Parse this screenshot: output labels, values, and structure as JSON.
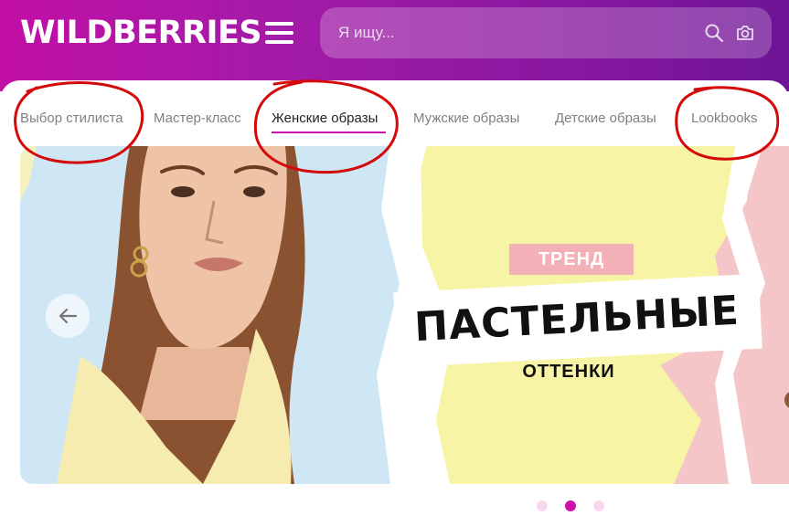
{
  "header": {
    "logo": "WILDBERRIES",
    "search_placeholder": "Я ищу...",
    "gradient_colors": [
      "#c10fa6",
      "#6e1496"
    ]
  },
  "icons": {
    "menu": "hamburger-menu-icon",
    "search": "search-icon",
    "camera": "camera-icon",
    "prev": "arrow-left-icon"
  },
  "tabs": [
    {
      "label": "Выбор стилиста",
      "active": false
    },
    {
      "label": "Мастер-класс",
      "active": false
    },
    {
      "label": "Женские образы",
      "active": true
    },
    {
      "label": "Мужские образы",
      "active": false
    },
    {
      "label": "Детские образы",
      "active": false
    },
    {
      "label": "Lookbooks",
      "active": false
    }
  ],
  "annotations": {
    "circled_tabs": [
      "Выбор стилиста",
      "Женские образы",
      "Lookbooks"
    ],
    "circle_color": "#d40a0a"
  },
  "banner": {
    "tag": "ТРЕНД",
    "title": "ПАСТЕЛЬНЫЕ",
    "subtitle": "ОТТЕНКИ",
    "colors": {
      "blue": "#cfe6f4",
      "yellow": "#f8f4a6",
      "pink": "#f4c6c8",
      "tag_bg": "#f3b0b6"
    }
  },
  "carousel": {
    "total_slides": 3,
    "active_slide": 2,
    "active_color": "#cb11ab",
    "inactive_color": "#f7d6ee"
  }
}
